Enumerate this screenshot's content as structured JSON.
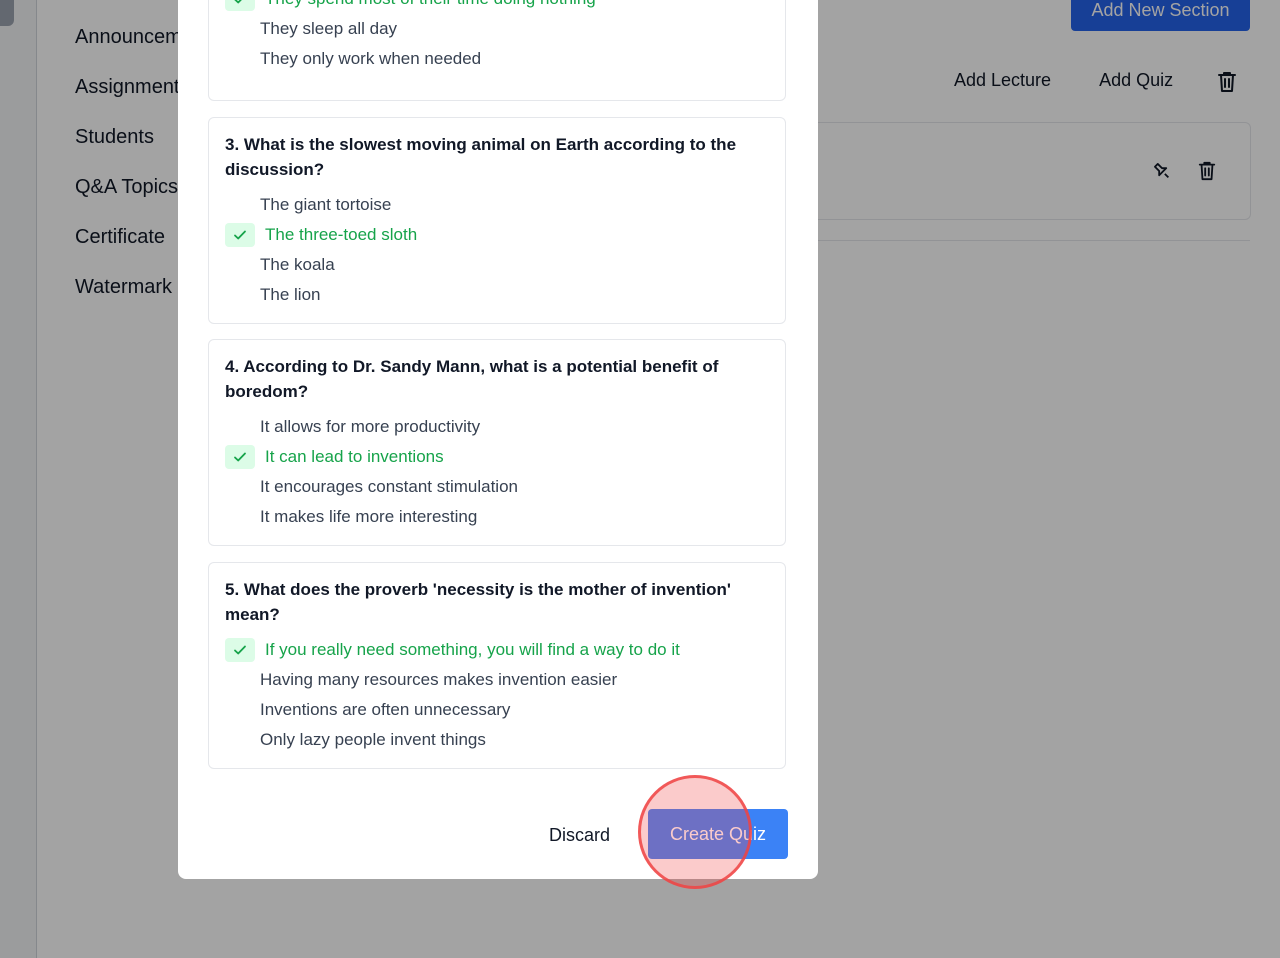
{
  "sidebar": {
    "nav": [
      "Announcements",
      "Assignments",
      "Students",
      "Q&A Topics",
      "Certificate",
      "Watermark"
    ]
  },
  "header": {
    "add_section": "Add New Section",
    "add_lecture": "Add Lecture",
    "add_quiz": "Add Quiz"
  },
  "modal": {
    "partial_options": [
      {
        "text": "They spend most of their time doing nothing",
        "correct": true
      },
      {
        "text": "They sleep all day",
        "correct": false
      },
      {
        "text": "They only work when needed",
        "correct": false
      }
    ],
    "questions": [
      {
        "title": "3. What is the slowest moving animal on Earth according to the discussion?",
        "options": [
          {
            "text": "The giant tortoise",
            "correct": false
          },
          {
            "text": "The three-toed sloth",
            "correct": true
          },
          {
            "text": "The koala",
            "correct": false
          },
          {
            "text": "The lion",
            "correct": false
          }
        ]
      },
      {
        "title": "4. According to Dr. Sandy Mann, what is a potential benefit of boredom?",
        "options": [
          {
            "text": "It allows for more productivity",
            "correct": false
          },
          {
            "text": "It can lead to inventions",
            "correct": true
          },
          {
            "text": "It encourages constant stimulation",
            "correct": false
          },
          {
            "text": "It makes life more interesting",
            "correct": false
          }
        ]
      },
      {
        "title": "5. What does the proverb 'necessity is the mother of invention' mean?",
        "options": [
          {
            "text": "If you really need something, you will find a way to do it",
            "correct": true
          },
          {
            "text": "Having many resources makes invention easier",
            "correct": false
          },
          {
            "text": "Inventions are often unnecessary",
            "correct": false
          },
          {
            "text": "Only lazy people invent things",
            "correct": false
          }
        ]
      }
    ],
    "discard": "Discard",
    "create": "Create Quiz"
  },
  "icons": {
    "check": "check-icon",
    "trash": "trash-icon",
    "pin": "pin-icon"
  },
  "colors": {
    "primary": "#3b82f6",
    "correct": "#16a34a",
    "correct_bg": "#dcfce7",
    "click_ring": "#ef4444"
  }
}
